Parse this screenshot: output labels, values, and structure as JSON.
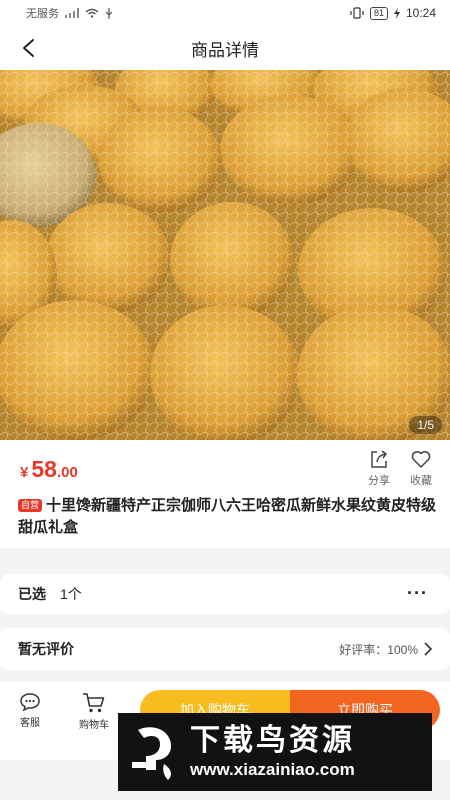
{
  "status_bar": {
    "carrier": "无服务",
    "battery": "81",
    "time": "10:24"
  },
  "nav": {
    "title": "商品详情"
  },
  "gallery": {
    "counter": "1/5"
  },
  "product": {
    "currency": "¥",
    "price_int": "58",
    "price_dec": ".00",
    "tag": "自营",
    "title": "十里馋新疆特产正宗伽师八六王哈密瓜新鲜水果纹黄皮特级甜瓜礼盒"
  },
  "actions": {
    "share": "分享",
    "favorite": "收藏"
  },
  "selected": {
    "label": "已选",
    "value": "1个"
  },
  "reviews": {
    "label": "暂无评价",
    "rate": "好评率：100%"
  },
  "bottom_bar": {
    "service": "客服",
    "cart": "购物车",
    "add_to_cart": "加入购物车",
    "buy_now": "立即购买"
  },
  "watermark": {
    "text": "下载鸟资源",
    "url": "www.xiazainiao.com"
  },
  "colors": {
    "price_red": "#e53a2a",
    "add_cart_yellow": "#f7bd1e",
    "buy_now_orange": "#f26622"
  }
}
